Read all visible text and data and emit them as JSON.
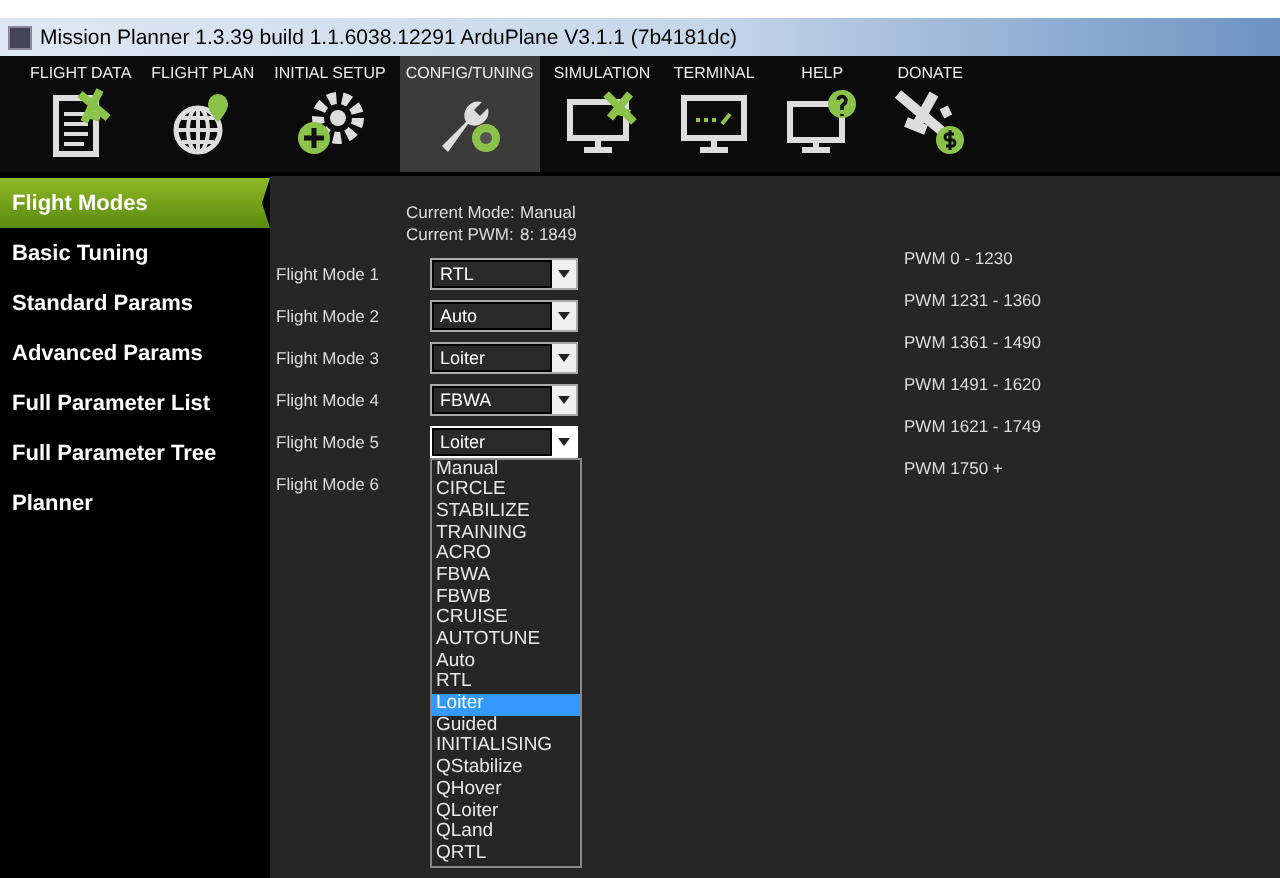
{
  "window": {
    "title": "Mission Planner 1.3.39 build 1.1.6038.12291 ArduPlane V3.1.1 (7b4181dc)"
  },
  "toolbar": [
    {
      "label": "FLIGHT DATA",
      "selected": false
    },
    {
      "label": "FLIGHT PLAN",
      "selected": false
    },
    {
      "label": "INITIAL SETUP",
      "selected": false
    },
    {
      "label": "CONFIG/TUNING",
      "selected": true
    },
    {
      "label": "SIMULATION",
      "selected": false
    },
    {
      "label": "TERMINAL",
      "selected": false
    },
    {
      "label": "HELP",
      "selected": false
    },
    {
      "label": "DONATE",
      "selected": false
    }
  ],
  "sidebar": {
    "items": [
      {
        "label": "Flight Modes",
        "selected": true
      },
      {
        "label": "Basic Tuning",
        "selected": false
      },
      {
        "label": "Standard Params",
        "selected": false
      },
      {
        "label": "Advanced Params",
        "selected": false
      },
      {
        "label": "Full Parameter List",
        "selected": false
      },
      {
        "label": "Full Parameter Tree",
        "selected": false
      },
      {
        "label": "Planner",
        "selected": false
      }
    ]
  },
  "status": [
    {
      "label": "Current Mode:",
      "value": "Manual"
    },
    {
      "label": "Current PWM:",
      "value": "8: 1849"
    }
  ],
  "modes": [
    {
      "label": "Flight Mode 1",
      "value": "RTL",
      "pwm": "PWM 0 - 1230",
      "expanded": false
    },
    {
      "label": "Flight Mode 2",
      "value": "Auto",
      "pwm": "PWM 1231 - 1360",
      "expanded": false
    },
    {
      "label": "Flight Mode 3",
      "value": "Loiter",
      "pwm": "PWM 1361 - 1490",
      "expanded": false
    },
    {
      "label": "Flight Mode 4",
      "value": "FBWA",
      "pwm": "PWM 1491 - 1620",
      "expanded": false
    },
    {
      "label": "Flight Mode 5",
      "value": "Loiter",
      "pwm": "PWM 1621 - 1749",
      "expanded": true
    },
    {
      "label": "Flight Mode 6",
      "pwm": "PWM 1750 +"
    }
  ],
  "dropdown_options": [
    {
      "label": "Manual",
      "selected": false
    },
    {
      "label": "CIRCLE",
      "selected": false
    },
    {
      "label": "STABILIZE",
      "selected": false
    },
    {
      "label": "TRAINING",
      "selected": false
    },
    {
      "label": "ACRO",
      "selected": false
    },
    {
      "label": "FBWA",
      "selected": false
    },
    {
      "label": "FBWB",
      "selected": false
    },
    {
      "label": "CRUISE",
      "selected": false
    },
    {
      "label": "AUTOTUNE",
      "selected": false
    },
    {
      "label": "Auto",
      "selected": false
    },
    {
      "label": "RTL",
      "selected": false
    },
    {
      "label": "Loiter",
      "selected": true
    },
    {
      "label": "Guided",
      "selected": false
    },
    {
      "label": "INITIALISING",
      "selected": false
    },
    {
      "label": "QStabilize",
      "selected": false
    },
    {
      "label": "QHover",
      "selected": false
    },
    {
      "label": "QLoiter",
      "selected": false
    },
    {
      "label": "QLand",
      "selected": false
    },
    {
      "label": "QRTL",
      "selected": false
    }
  ]
}
